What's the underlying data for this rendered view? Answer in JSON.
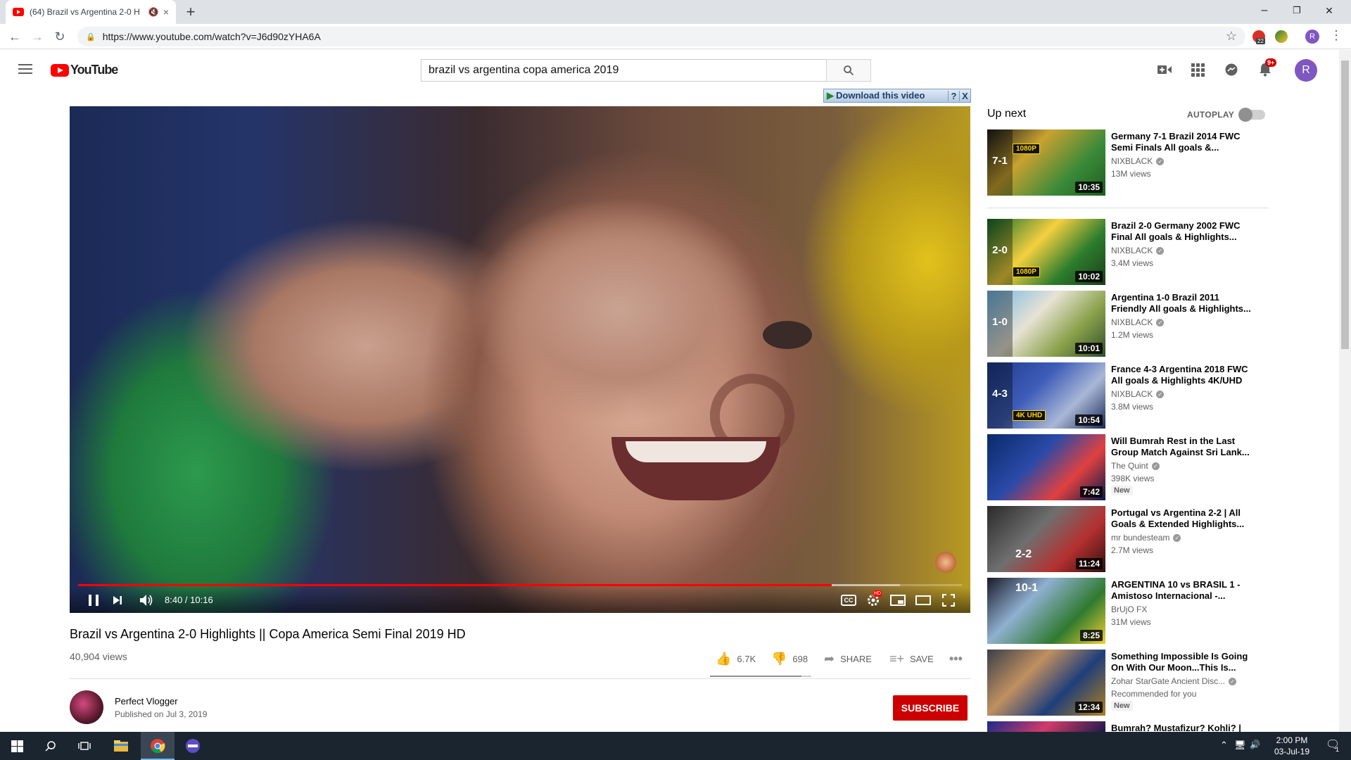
{
  "browser": {
    "tab_title": "(64) Brazil vs Argentina 2-0 H",
    "tab_audio_icon": "speaker-muted-icon",
    "new_tab": "+",
    "tab_close": "×",
    "url": "https://www.youtube.com/watch?v=J6d90zYHA6A",
    "extension_badge": "22",
    "profile_initial": "R",
    "window_controls": [
      "–",
      "❐",
      "✕"
    ]
  },
  "youtube": {
    "logo_text": "YouTube",
    "search_query": "brazil vs argentina copa america 2019",
    "notification_count": "9+",
    "avatar_initial": "R"
  },
  "download_helper": {
    "label": "Download this video",
    "help": "?",
    "close": "X"
  },
  "player": {
    "current_time": "8:40",
    "duration": "10:16",
    "time_display": "8:40 / 10:16",
    "played_fraction": 0.853,
    "buffered_fraction": 0.93,
    "cc_label": "CC",
    "hd_label": "HD"
  },
  "video": {
    "title": "Brazil vs Argentina 2-0 Highlights || Copa America Semi Final 2019 HD",
    "views": "40,904 views",
    "likes": "6.7K",
    "dislikes": "698",
    "like_ratio": 0.906,
    "share_label": "SHARE",
    "save_label": "SAVE"
  },
  "channel": {
    "name": "Perfect Vlogger",
    "published": "Published on Jul 3, 2019",
    "subscribe_label": "SUBSCRIBE"
  },
  "sidebar": {
    "upnext_label": "Up next",
    "autoplay_label": "AUTOPLAY",
    "autoplay_on": false,
    "items": [
      {
        "title": "Germany 7-1 Brazil 2014 FWC Semi Finals All goals &...",
        "channel": "NIXBLACK",
        "verified": true,
        "views": "13M views",
        "duration": "10:35",
        "score": "7-1",
        "badge": "1080P",
        "new": ""
      },
      {
        "title": "Brazil 2-0 Germany 2002 FWC Final All goals & Highlights...",
        "channel": "NIXBLACK",
        "verified": true,
        "views": "3.4M views",
        "duration": "10:02",
        "score": "2-0",
        "badge": "1080P",
        "new": ""
      },
      {
        "title": "Argentina 1-0 Brazil 2011 Friendly All goals & Highlights...",
        "channel": "NIXBLACK",
        "verified": true,
        "views": "1.2M views",
        "duration": "10:01",
        "score": "1-0",
        "badge": "",
        "new": ""
      },
      {
        "title": "France 4-3 Argentina 2018 FWC All goals & Highlights 4K/UHD",
        "channel": "NIXBLACK",
        "verified": true,
        "views": "3.8M views",
        "duration": "10:54",
        "score": "4-3",
        "badge": "4K UHD",
        "new": ""
      },
      {
        "title": "Will Bumrah Rest in the Last Group Match Against Sri Lank...",
        "channel": "The Quint",
        "verified": true,
        "views": "398K views",
        "duration": "7:42",
        "score": "",
        "badge": "",
        "new": "New"
      },
      {
        "title": "Portugal vs Argentina 2-2 | All Goals & Extended Highlights...",
        "channel": "mr bundesteam",
        "verified": true,
        "views": "2.7M views",
        "duration": "11:24",
        "score": "2-2",
        "badge": "",
        "new": ""
      },
      {
        "title": "ARGENTINA 10 vs BRASIL 1 - Amistoso Internacional -...",
        "channel": "BrUjO FX",
        "verified": false,
        "views": "31M views",
        "duration": "8:25",
        "score": "10-1",
        "badge": "",
        "new": ""
      },
      {
        "title": "Something Impossible Is Going On With Our Moon...This Is...",
        "channel": "Zohar StarGate Ancient Disc...",
        "verified": true,
        "views": "Recommended for you",
        "duration": "12:34",
        "score": "",
        "badge": "",
        "new": "New"
      },
      {
        "title": "Bumrah? Mustafizur? Kohli? |",
        "channel": "",
        "verified": false,
        "views": "",
        "duration": "",
        "score": "",
        "badge": "",
        "new": ""
      }
    ]
  },
  "taskbar": {
    "time": "2:00 PM",
    "date": "03-Jul-19",
    "notification_count": "1"
  },
  "colors": {
    "youtube_red": "#ff0000",
    "subscribe_red": "#cc0000",
    "taskbar": "#1b2530",
    "chrome_tabstrip": "#dee1e6"
  },
  "icons": [
    "hamburger-menu-icon",
    "search-icon",
    "create-video-icon",
    "apps-icon",
    "messages-icon",
    "bell-icon",
    "like-icon",
    "dislike-icon",
    "share-icon",
    "save-playlist-icon",
    "more-icon",
    "pause-icon",
    "next-icon",
    "volume-icon",
    "settings-icon",
    "miniplayer-icon",
    "theater-icon",
    "fullscreen-icon",
    "windows-start-icon",
    "cortana-search-icon",
    "task-view-icon",
    "file-explorer-icon",
    "chrome-icon",
    "media-app-icon"
  ]
}
